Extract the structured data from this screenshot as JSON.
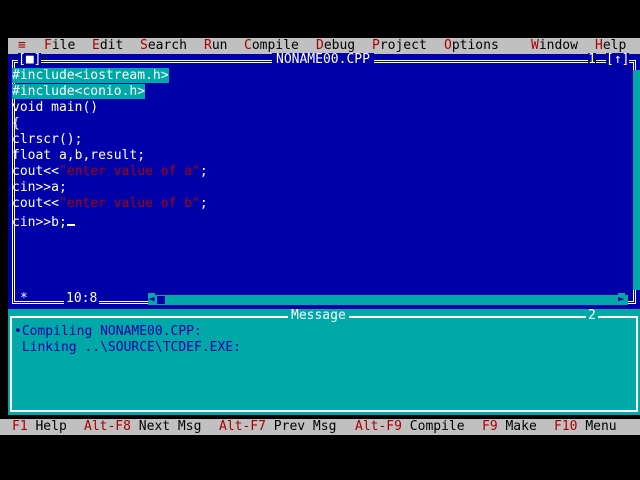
{
  "menu": {
    "system": "≡",
    "items": [
      {
        "hot": "F",
        "rest": "ile"
      },
      {
        "hot": "E",
        "rest": "dit"
      },
      {
        "hot": "S",
        "rest": "earch"
      },
      {
        "hot": "R",
        "rest": "un"
      },
      {
        "hot": "C",
        "rest": "ompile"
      },
      {
        "hot": "D",
        "rest": "ebug"
      },
      {
        "hot": "P",
        "rest": "roject"
      },
      {
        "hot": "O",
        "rest": "ptions"
      },
      {
        "hot": "W",
        "rest": "indow"
      },
      {
        "hot": "H",
        "rest": "elp"
      }
    ]
  },
  "editor": {
    "title": "NONAME00.CPP",
    "close_button": "[■]",
    "window_number": "1",
    "zoom_button": "[↑]",
    "lines": [
      {
        "parts": [
          {
            "t": "#include<iostream.h>",
            "c": "sel"
          }
        ]
      },
      {
        "parts": [
          {
            "t": "#include<conio.h>",
            "c": "sel"
          }
        ]
      },
      {
        "parts": [
          {
            "t": "void main()",
            "c": "kw"
          }
        ]
      },
      {
        "parts": [
          {
            "t": "{",
            "c": "kw"
          }
        ]
      },
      {
        "parts": [
          {
            "t": "clrscr();",
            "c": "kw"
          }
        ]
      },
      {
        "parts": [
          {
            "t": "float a,b,result;",
            "c": "kw"
          }
        ]
      },
      {
        "parts": [
          {
            "t": "cout<<",
            "c": "kw"
          },
          {
            "t": "\"enter value of a\"",
            "c": "str"
          },
          {
            "t": ";",
            "c": "kw"
          }
        ]
      },
      {
        "parts": [
          {
            "t": "cin>>a;",
            "c": "kw"
          }
        ]
      },
      {
        "parts": [
          {
            "t": "cout<<",
            "c": "kw"
          },
          {
            "t": "\"enter value of b\"",
            "c": "str"
          },
          {
            "t": ";",
            "c": "kw"
          }
        ]
      },
      {
        "parts": [
          {
            "t": "cin>>b;",
            "c": "kw"
          }
        ]
      }
    ],
    "cursor_position": "10:8",
    "modified_marker": "*"
  },
  "message": {
    "title": "Message",
    "window_number": "2",
    "lines": [
      {
        "text": "•Compiling NONAME00.CPP:",
        "highlight": false
      },
      {
        "text": " Linking ..\\SOURCE\\TCDEF.EXE:",
        "highlight": true
      }
    ]
  },
  "status": {
    "items": [
      {
        "key": "F1",
        "label": "Help"
      },
      {
        "key": "Alt-F8",
        "label": "Next Msg"
      },
      {
        "key": "Alt-F7",
        "label": "Prev Msg"
      },
      {
        "key": "Alt-F9",
        "label": "Compile"
      },
      {
        "key": "F9",
        "label": "Make"
      },
      {
        "key": "F10",
        "label": "Menu"
      }
    ]
  },
  "colors": {
    "editor_bg": "#0000a8",
    "message_bg": "#00a8a8",
    "menu_bg": "#c0c0c0",
    "hotkey": "#a80000"
  }
}
